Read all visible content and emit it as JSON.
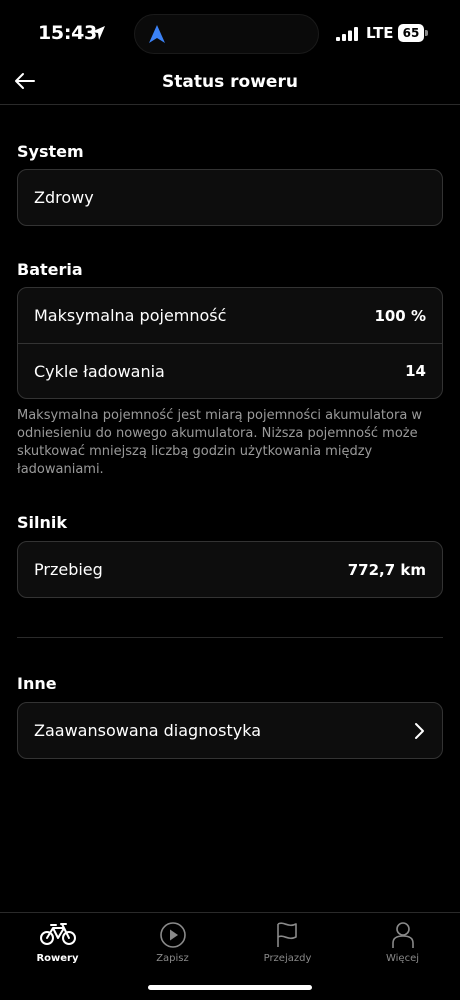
{
  "status_bar": {
    "time": "15:43",
    "network": "LTE",
    "battery": "65"
  },
  "header": {
    "title": "Status roweru",
    "back_icon": "arrow-left-icon"
  },
  "sections": {
    "system": {
      "label": "System",
      "value": "Zdrowy"
    },
    "battery": {
      "label": "Bateria",
      "rows": [
        {
          "label": "Maksymalna pojemność",
          "value": "100 %"
        },
        {
          "label": "Cykle ładowania",
          "value": "14"
        }
      ],
      "note": "Maksymalna pojemność jest miarą pojemności akumulatora w odniesieniu do nowego akumulatora. Niższa pojemność może skutkować mniejszą liczbą godzin użytkowania między ładowaniami."
    },
    "motor": {
      "label": "Silnik",
      "rows": [
        {
          "label": "Przebieg",
          "value": "772,7 km"
        }
      ]
    },
    "other": {
      "label": "Inne",
      "rows": [
        {
          "label": "Zaawansowana diagnostyka",
          "icon": "chevron-right-icon"
        }
      ]
    }
  },
  "tabbar": {
    "tabs": [
      {
        "label": "Rowery",
        "icon": "bicycle-icon",
        "active": true
      },
      {
        "label": "Zapisz",
        "icon": "play-circle-icon",
        "active": false
      },
      {
        "label": "Przejazdy",
        "icon": "flag-icon",
        "active": false
      },
      {
        "label": "Więcej",
        "icon": "person-icon",
        "active": false
      }
    ]
  },
  "colors": {
    "background": "#000000",
    "card_border": "#333333",
    "note_text": "#9a9a9a",
    "nav_accent": "#3b82f6"
  }
}
